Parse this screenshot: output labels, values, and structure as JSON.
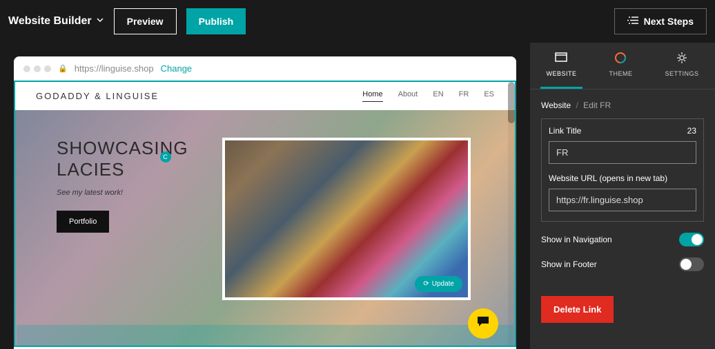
{
  "header": {
    "brand": "Website Builder",
    "preview_label": "Preview",
    "publish_label": "Publish",
    "next_steps_label": "Next Steps"
  },
  "url_bar": {
    "url": "https://linguise.shop",
    "change_label": "Change"
  },
  "site": {
    "logo": "GODADDY & LINGUISE",
    "nav": {
      "home": "Home",
      "about": "About",
      "en": "EN",
      "fr": "FR",
      "es": "ES"
    },
    "hero": {
      "title_l1": "SHOWCASING",
      "title_l2": "LACIES",
      "subtitle": "See my latest work!",
      "button": "Portfolio"
    },
    "update_label": "Update"
  },
  "panel": {
    "tabs": {
      "website": "WEBSITE",
      "theme": "THEME",
      "settings": "SETTINGS"
    },
    "crumbs": {
      "root": "Website",
      "leaf": "Edit FR"
    },
    "link_title_label": "Link Title",
    "count": "23",
    "link_title_value": "FR",
    "url_label": "Website URL (opens in new tab)",
    "url_value": "https://fr.linguise.shop",
    "show_nav": "Show in Navigation",
    "show_footer": "Show in Footer",
    "delete": "Delete Link"
  }
}
